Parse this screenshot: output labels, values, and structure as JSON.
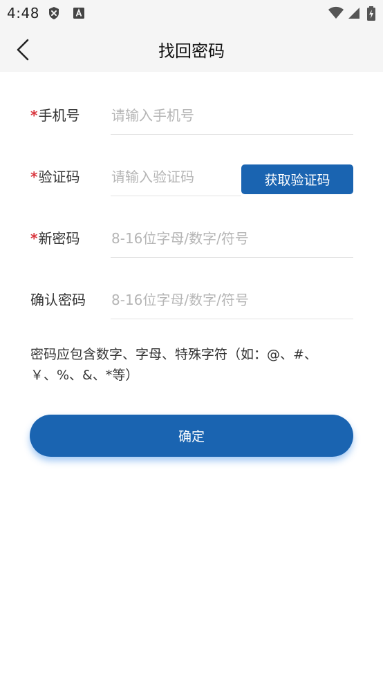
{
  "status_bar": {
    "time": "4:48",
    "left_icons": [
      "shield-x-icon",
      "font-a-icon"
    ],
    "right_icons": [
      "wifi-icon",
      "signal-icon",
      "battery-charging-icon"
    ]
  },
  "header": {
    "title": "找回密码",
    "back_icon": "chevron-left-icon"
  },
  "form": {
    "phone": {
      "required_mark": "*",
      "label": "手机号",
      "placeholder": "请输入手机号",
      "value": ""
    },
    "code": {
      "required_mark": "*",
      "label": "验证码",
      "placeholder": "请输入验证码",
      "value": "",
      "button_label": "获取验证码"
    },
    "new_password": {
      "required_mark": "*",
      "label": "新密码",
      "placeholder": "8-16位字母/数字/符号",
      "value": ""
    },
    "confirm_password": {
      "label": "确认密码",
      "placeholder": "8-16位字母/数字/符号",
      "value": ""
    }
  },
  "hint": "密码应包含数字、字母、特殊字符（如：@、#、￥、%、&、*等）",
  "submit_label": "确定",
  "colors": {
    "primary": "#1a64b1",
    "required": "#d9363e",
    "header_bg": "#f5f5f5",
    "placeholder": "#b5b5b5"
  }
}
